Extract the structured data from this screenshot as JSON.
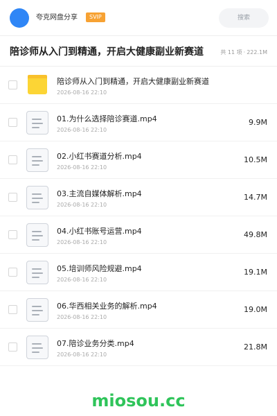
{
  "header": {
    "app_name": "夸克网盘分享",
    "badge": "SVIP",
    "search_placeholder": "搜索",
    "avatar_color": "#2f86f6",
    "badge_color": "#f7a233"
  },
  "title_bar": {
    "title": "陪诊师从入门到精通，开启大健康副业新赛道",
    "count": "共 11 项",
    "separator": "·",
    "total_size": "222.1M"
  },
  "items": [
    {
      "type": "folder",
      "icon": "folder-icon",
      "name": "陪诊师从入门到精通，开启大健康副业新赛道",
      "date": "2026-08-16 22:10",
      "size": ""
    },
    {
      "type": "file",
      "icon": "document-icon",
      "name": "01.为什么选择陪诊赛道.mp4",
      "date": "2026-08-16 22:10",
      "size": "9.9M"
    },
    {
      "type": "file",
      "icon": "document-icon",
      "name": "02.小红书赛道分析.mp4",
      "date": "2026-08-16 22:10",
      "size": "10.5M"
    },
    {
      "type": "file",
      "icon": "document-icon",
      "name": "03.主流自媒体解析.mp4",
      "date": "2026-08-16 22:10",
      "size": "14.7M"
    },
    {
      "type": "file",
      "icon": "document-icon",
      "name": "04.小红书账号运营.mp4",
      "date": "2026-08-16 22:10",
      "size": "49.8M"
    },
    {
      "type": "file",
      "icon": "document-icon",
      "name": "05.培训师风险规避.mp4",
      "date": "2026-08-16 22:10",
      "size": "19.1M"
    },
    {
      "type": "file",
      "icon": "document-icon",
      "name": "06.华西相关业务的解析.mp4",
      "date": "2026-08-16 22:10",
      "size": "19.0M"
    },
    {
      "type": "file",
      "icon": "document-icon",
      "name": "07.陪诊业务分类.mp4",
      "date": "2026-08-16 22:10",
      "size": "21.8M"
    }
  ],
  "watermark": {
    "text": "miosou.cc",
    "color": "#2fc45a"
  }
}
